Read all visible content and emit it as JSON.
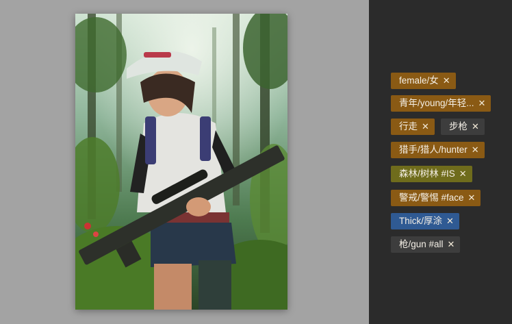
{
  "tags": [
    {
      "label": "female/女",
      "close": "✕",
      "color": "#8a5a14"
    },
    {
      "label": "青年/young/年轻...",
      "close": "✕",
      "color": "#8a5a14"
    },
    {
      "label": "行走",
      "close": "✕",
      "color": "#8a5a14"
    },
    {
      "label": "步枪",
      "close": "✕",
      "color": "#3d3d3d"
    },
    {
      "label": "猎手/猎人/hunter",
      "close": "✕",
      "color": "#8a5a14"
    },
    {
      "label": "森林/树林 #IS",
      "close": "✕",
      "color": "#6f6c1c"
    },
    {
      "label": "警戒/警惕 #face",
      "close": "✕",
      "color": "#8a5a14"
    },
    {
      "label": "Thick/厚涂",
      "close": "✕",
      "color": "#2f5a93"
    },
    {
      "label": "枪/gun #all",
      "close": "✕",
      "color": "#3d3d3d"
    }
  ]
}
